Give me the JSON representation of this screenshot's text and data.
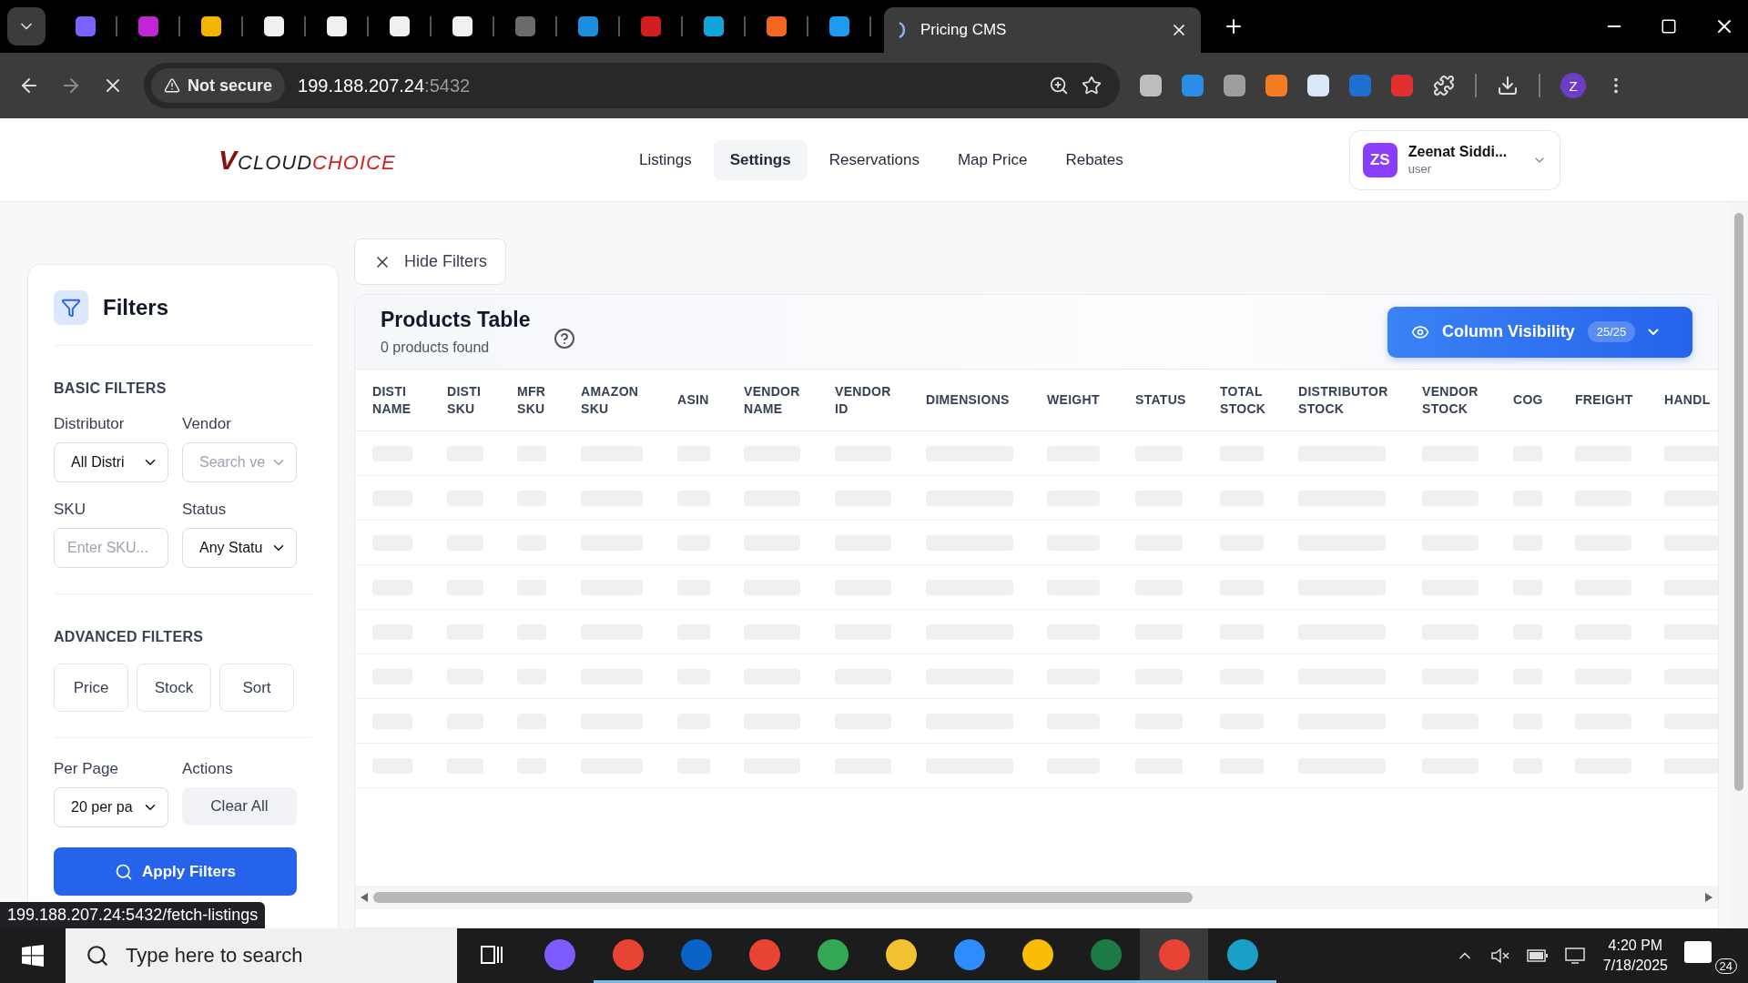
{
  "browser": {
    "pinned_tabs": [
      {
        "color": "#7b61ff"
      },
      {
        "color": "#c026d3"
      },
      {
        "color": "#f5b400"
      },
      {
        "color": "#f0f0f0"
      },
      {
        "color": "#f0f0f0"
      },
      {
        "color": "#f0f0f0"
      },
      {
        "color": "#f0f0f0"
      },
      {
        "color": "#6b6b6b"
      },
      {
        "color": "#1a8fe0"
      },
      {
        "color": "#d11f1f"
      },
      {
        "color": "#10a5d8"
      },
      {
        "color": "#f26522"
      },
      {
        "color": "#1e9bf0"
      }
    ],
    "active_tab": {
      "title": "Pricing CMS"
    },
    "address": {
      "security": "Not secure",
      "host": "199.188.207.24",
      "port": ":5432"
    },
    "extensions": [
      {
        "color": "#bdbdbd"
      },
      {
        "color": "#2a8ee8"
      },
      {
        "color": "#9e9e9e"
      },
      {
        "color": "#f57c20"
      },
      {
        "color": "#d8e8f8"
      },
      {
        "color": "#1f6fd1"
      },
      {
        "color": "#e23030"
      }
    ],
    "profile_initial": "Z"
  },
  "app": {
    "logo": {
      "mark": "V",
      "part_1": "CLOUD",
      "part_2": "CHOICE"
    },
    "nav": [
      {
        "label": "Listings",
        "selected": false
      },
      {
        "label": "Settings",
        "selected": true
      },
      {
        "label": "Reservations",
        "selected": false
      },
      {
        "label": "Map Price",
        "selected": false
      },
      {
        "label": "Rebates",
        "selected": false
      }
    ],
    "user": {
      "initials": "ZS",
      "name": "Zeenat Siddi...",
      "role": "user"
    }
  },
  "filters": {
    "title": "Filters",
    "hide_button": "Hide Filters",
    "basic_heading": "BASIC FILTERS",
    "basic_fields": [
      {
        "kind": "select",
        "label": "Distributor",
        "value": "All Distri"
      },
      {
        "kind": "select",
        "label": "Vendor",
        "placeholder": "Search ve"
      },
      {
        "kind": "input",
        "label": "SKU",
        "placeholder": "Enter SKU..."
      },
      {
        "kind": "select",
        "label": "Status",
        "value": "Any Statu"
      }
    ],
    "advanced_heading": "ADVANCED FILTERS",
    "advanced_buttons": [
      "Price",
      "Stock",
      "Sort"
    ],
    "per_page": {
      "label": "Per Page",
      "value": "20 per pa"
    },
    "actions": {
      "label": "Actions",
      "clear": "Clear All"
    },
    "apply": "Apply Filters"
  },
  "table": {
    "title": "Products Table",
    "subtitle": "0 products found",
    "column_visibility": {
      "label": "Column Visibility",
      "count": "25/25"
    },
    "columns": [
      [
        "DISTI",
        "NAME"
      ],
      [
        "DISTI",
        "SKU"
      ],
      [
        "MFR",
        "SKU"
      ],
      [
        "AMAZON",
        "SKU"
      ],
      [
        "ASIN"
      ],
      [
        "VENDOR",
        "NAME"
      ],
      [
        "VENDOR",
        "ID"
      ],
      [
        "DIMENSIONS"
      ],
      [
        "WEIGHT"
      ],
      [
        "STATUS"
      ],
      [
        "TOTAL",
        "STOCK"
      ],
      [
        "DISTRIBUTOR",
        "STOCK"
      ],
      [
        "VENDOR",
        "STOCK"
      ],
      [
        "COG"
      ],
      [
        "FREIGHT"
      ],
      [
        "HANDL"
      ]
    ]
  },
  "status_tooltip": "199.188.207.24:5432/fetch-listings",
  "taskbar": {
    "search_placeholder": "Type here to search",
    "apps": [
      {
        "color": "#7c5cff",
        "running": false,
        "selected": false
      },
      {
        "color": "#e94335",
        "running": true,
        "selected": false
      },
      {
        "color": "#0a64c8",
        "running": true,
        "selected": false
      },
      {
        "color": "#e94335",
        "running": true,
        "selected": false
      },
      {
        "color": "#34a853",
        "running": true,
        "selected": false
      },
      {
        "color": "#f2c230",
        "running": true,
        "selected": false
      },
      {
        "color": "#2d8cff",
        "running": true,
        "selected": false
      },
      {
        "color": "#fbbc05",
        "running": true,
        "selected": false
      },
      {
        "color": "#1d7a44",
        "running": true,
        "selected": false
      },
      {
        "color": "#e94335",
        "running": true,
        "selected": true
      },
      {
        "color": "#1aa0c8",
        "running": true,
        "selected": false
      }
    ],
    "time": "4:20 PM",
    "date": "7/18/2025",
    "notifications": "24"
  }
}
